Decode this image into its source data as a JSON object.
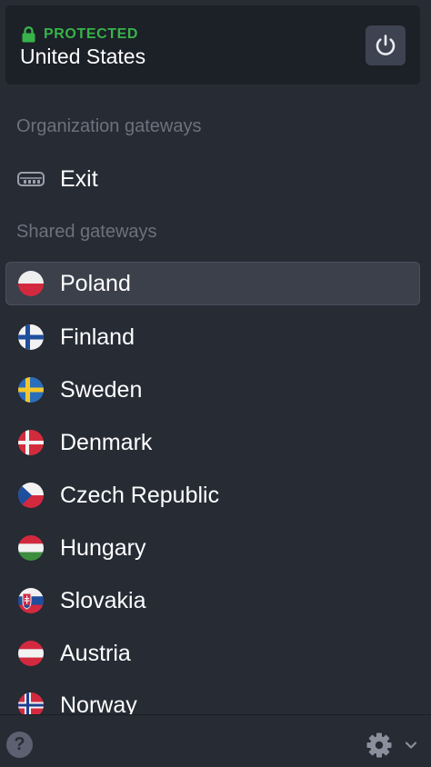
{
  "status": {
    "state_label": "PROTECTED",
    "location": "United States",
    "accent_color": "#37b34a"
  },
  "sections": {
    "organization": {
      "title": "Organization gateways",
      "items": [
        {
          "label": "Exit",
          "icon": "server-icon"
        }
      ]
    },
    "shared": {
      "title": "Shared gateways",
      "items": [
        {
          "label": "Poland",
          "icon": "flag-poland-icon",
          "selected": true
        },
        {
          "label": "Finland",
          "icon": "flag-finland-icon"
        },
        {
          "label": "Sweden",
          "icon": "flag-sweden-icon"
        },
        {
          "label": "Denmark",
          "icon": "flag-denmark-icon"
        },
        {
          "label": "Czech Republic",
          "icon": "flag-czech-icon"
        },
        {
          "label": "Hungary",
          "icon": "flag-hungary-icon"
        },
        {
          "label": "Slovakia",
          "icon": "flag-slovakia-icon"
        },
        {
          "label": "Austria",
          "icon": "flag-austria-icon"
        },
        {
          "label": "Norway",
          "icon": "flag-norway-icon"
        }
      ]
    }
  },
  "footer": {
    "help_label": "?",
    "help_icon": "help-icon",
    "settings_icon": "gear-icon"
  }
}
